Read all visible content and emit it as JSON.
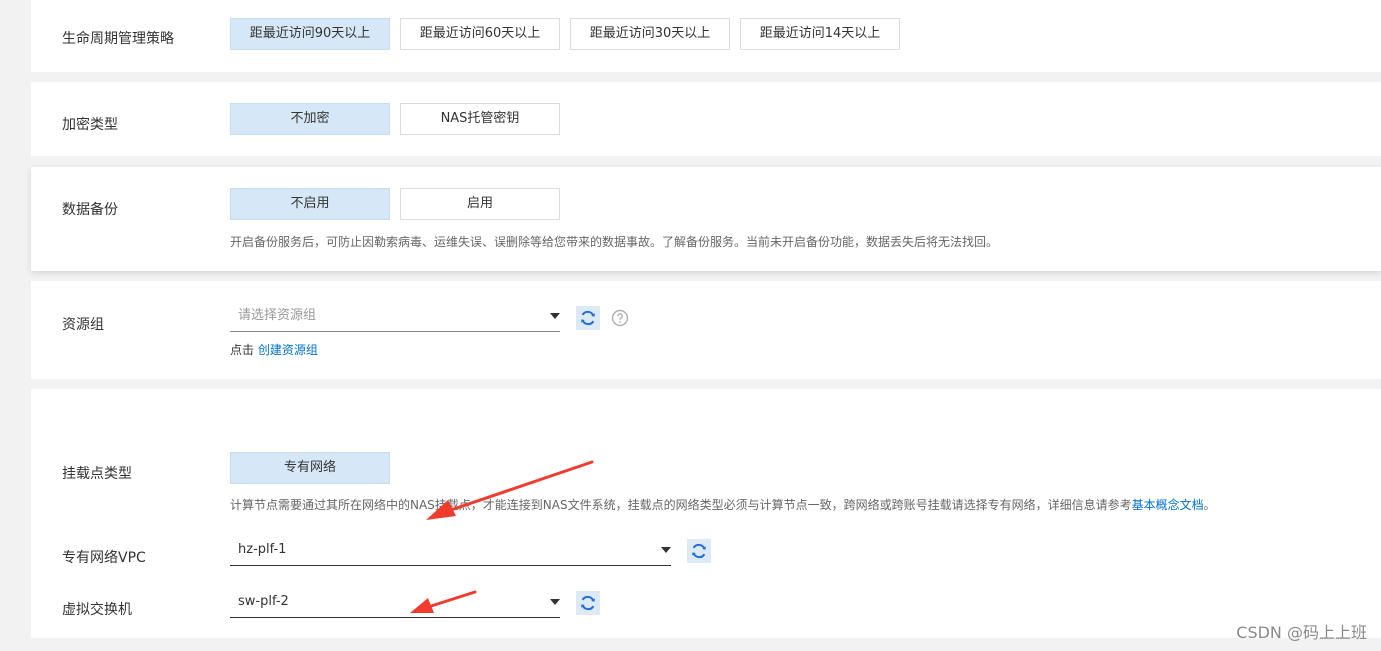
{
  "lifecycle": {
    "label": "生命周期管理策略",
    "options": [
      "距最近访问90天以上",
      "距最近访问60天以上",
      "距最近访问30天以上",
      "距最近访问14天以上"
    ]
  },
  "encryption": {
    "label": "加密类型",
    "options": [
      "不加密",
      "NAS托管密钥"
    ]
  },
  "backup": {
    "label": "数据备份",
    "options": [
      "不启用",
      "启用"
    ],
    "help": "开启备份服务后，可防止因勒索病毒、运维失误、误删除等给您带来的数据事故。了解备份服务。当前未开启备份功能，数据丢失后将无法找回。"
  },
  "resource_group": {
    "label": "资源组",
    "placeholder": "请选择资源组",
    "create_prefix": "点击",
    "create_link": "创建资源组"
  },
  "mount": {
    "label": "挂载点类型",
    "option": "专有网络",
    "help_text": "计算节点需要通过其所在网络中的NAS挂载点，才能连接到NAS文件系统，挂载点的网络类型必须与计算节点一致，跨网络或跨账号挂载请选择专有网络，详细信息请参考",
    "help_link": "基本概念文档",
    "help_end": "。"
  },
  "vpc": {
    "label": "专有网络VPC",
    "value": "hz-plf-1"
  },
  "vswitch": {
    "label": "虚拟交换机",
    "value": "sw-plf-2"
  },
  "watermark": "CSDN @码上上班",
  "colors": {
    "active_bg": "#d6e8f7",
    "link": "#0070cc",
    "arrow": "#f03c2e",
    "refresh_icon": "#1e6fd9"
  },
  "icons": [
    "refresh-icon",
    "question-icon",
    "caret-down-icon"
  ]
}
